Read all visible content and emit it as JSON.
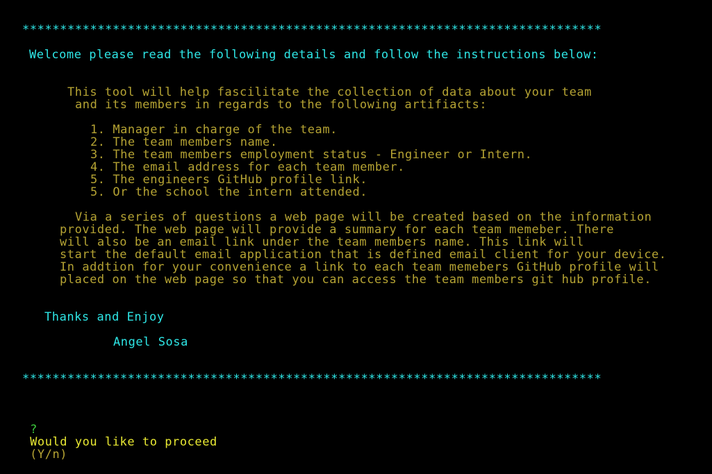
{
  "colors": {
    "heading": "#2ee6e6",
    "body": "#b5a333",
    "prompt": "#e8e832",
    "prompt_marker": "#3cc83c",
    "background": "#000000"
  },
  "banner": {
    "top_border": "*****************************************************************************",
    "welcome": "Welcome please read the following details and follow the instructions below:",
    "bottom_border": "*****************************************************************************"
  },
  "intro": [
    "This tool will help fascilitate the collection of data about your team",
    "and its members in regards to the following artifiacts:"
  ],
  "list": [
    "1. Manager in charge of the team.",
    "2. The team members name.",
    "3. The team members employment status - Engineer or Intern.",
    "4. The email address for each team member.",
    "5. The engineers GitHub profile link.",
    "5. Or the school the intern attended."
  ],
  "description": [
    "Via a series of questions a web page will be created based on the information",
    "provided. The web page will provide a summary for each team memeber. There",
    "will also be an email link under the team members name. This link will",
    "start the default email application that is defined email client for your device.",
    "In addtion for your convenience a link to each team memebers GitHub profile will",
    "placed on the web page so that you can access the team members git hub profile."
  ],
  "closing": {
    "thanks": "Thanks and Enjoy",
    "author": "Angel Sosa"
  },
  "prompt": {
    "marker": "?",
    "question": "Would you like to proceed",
    "hint": "(Y/n)"
  }
}
